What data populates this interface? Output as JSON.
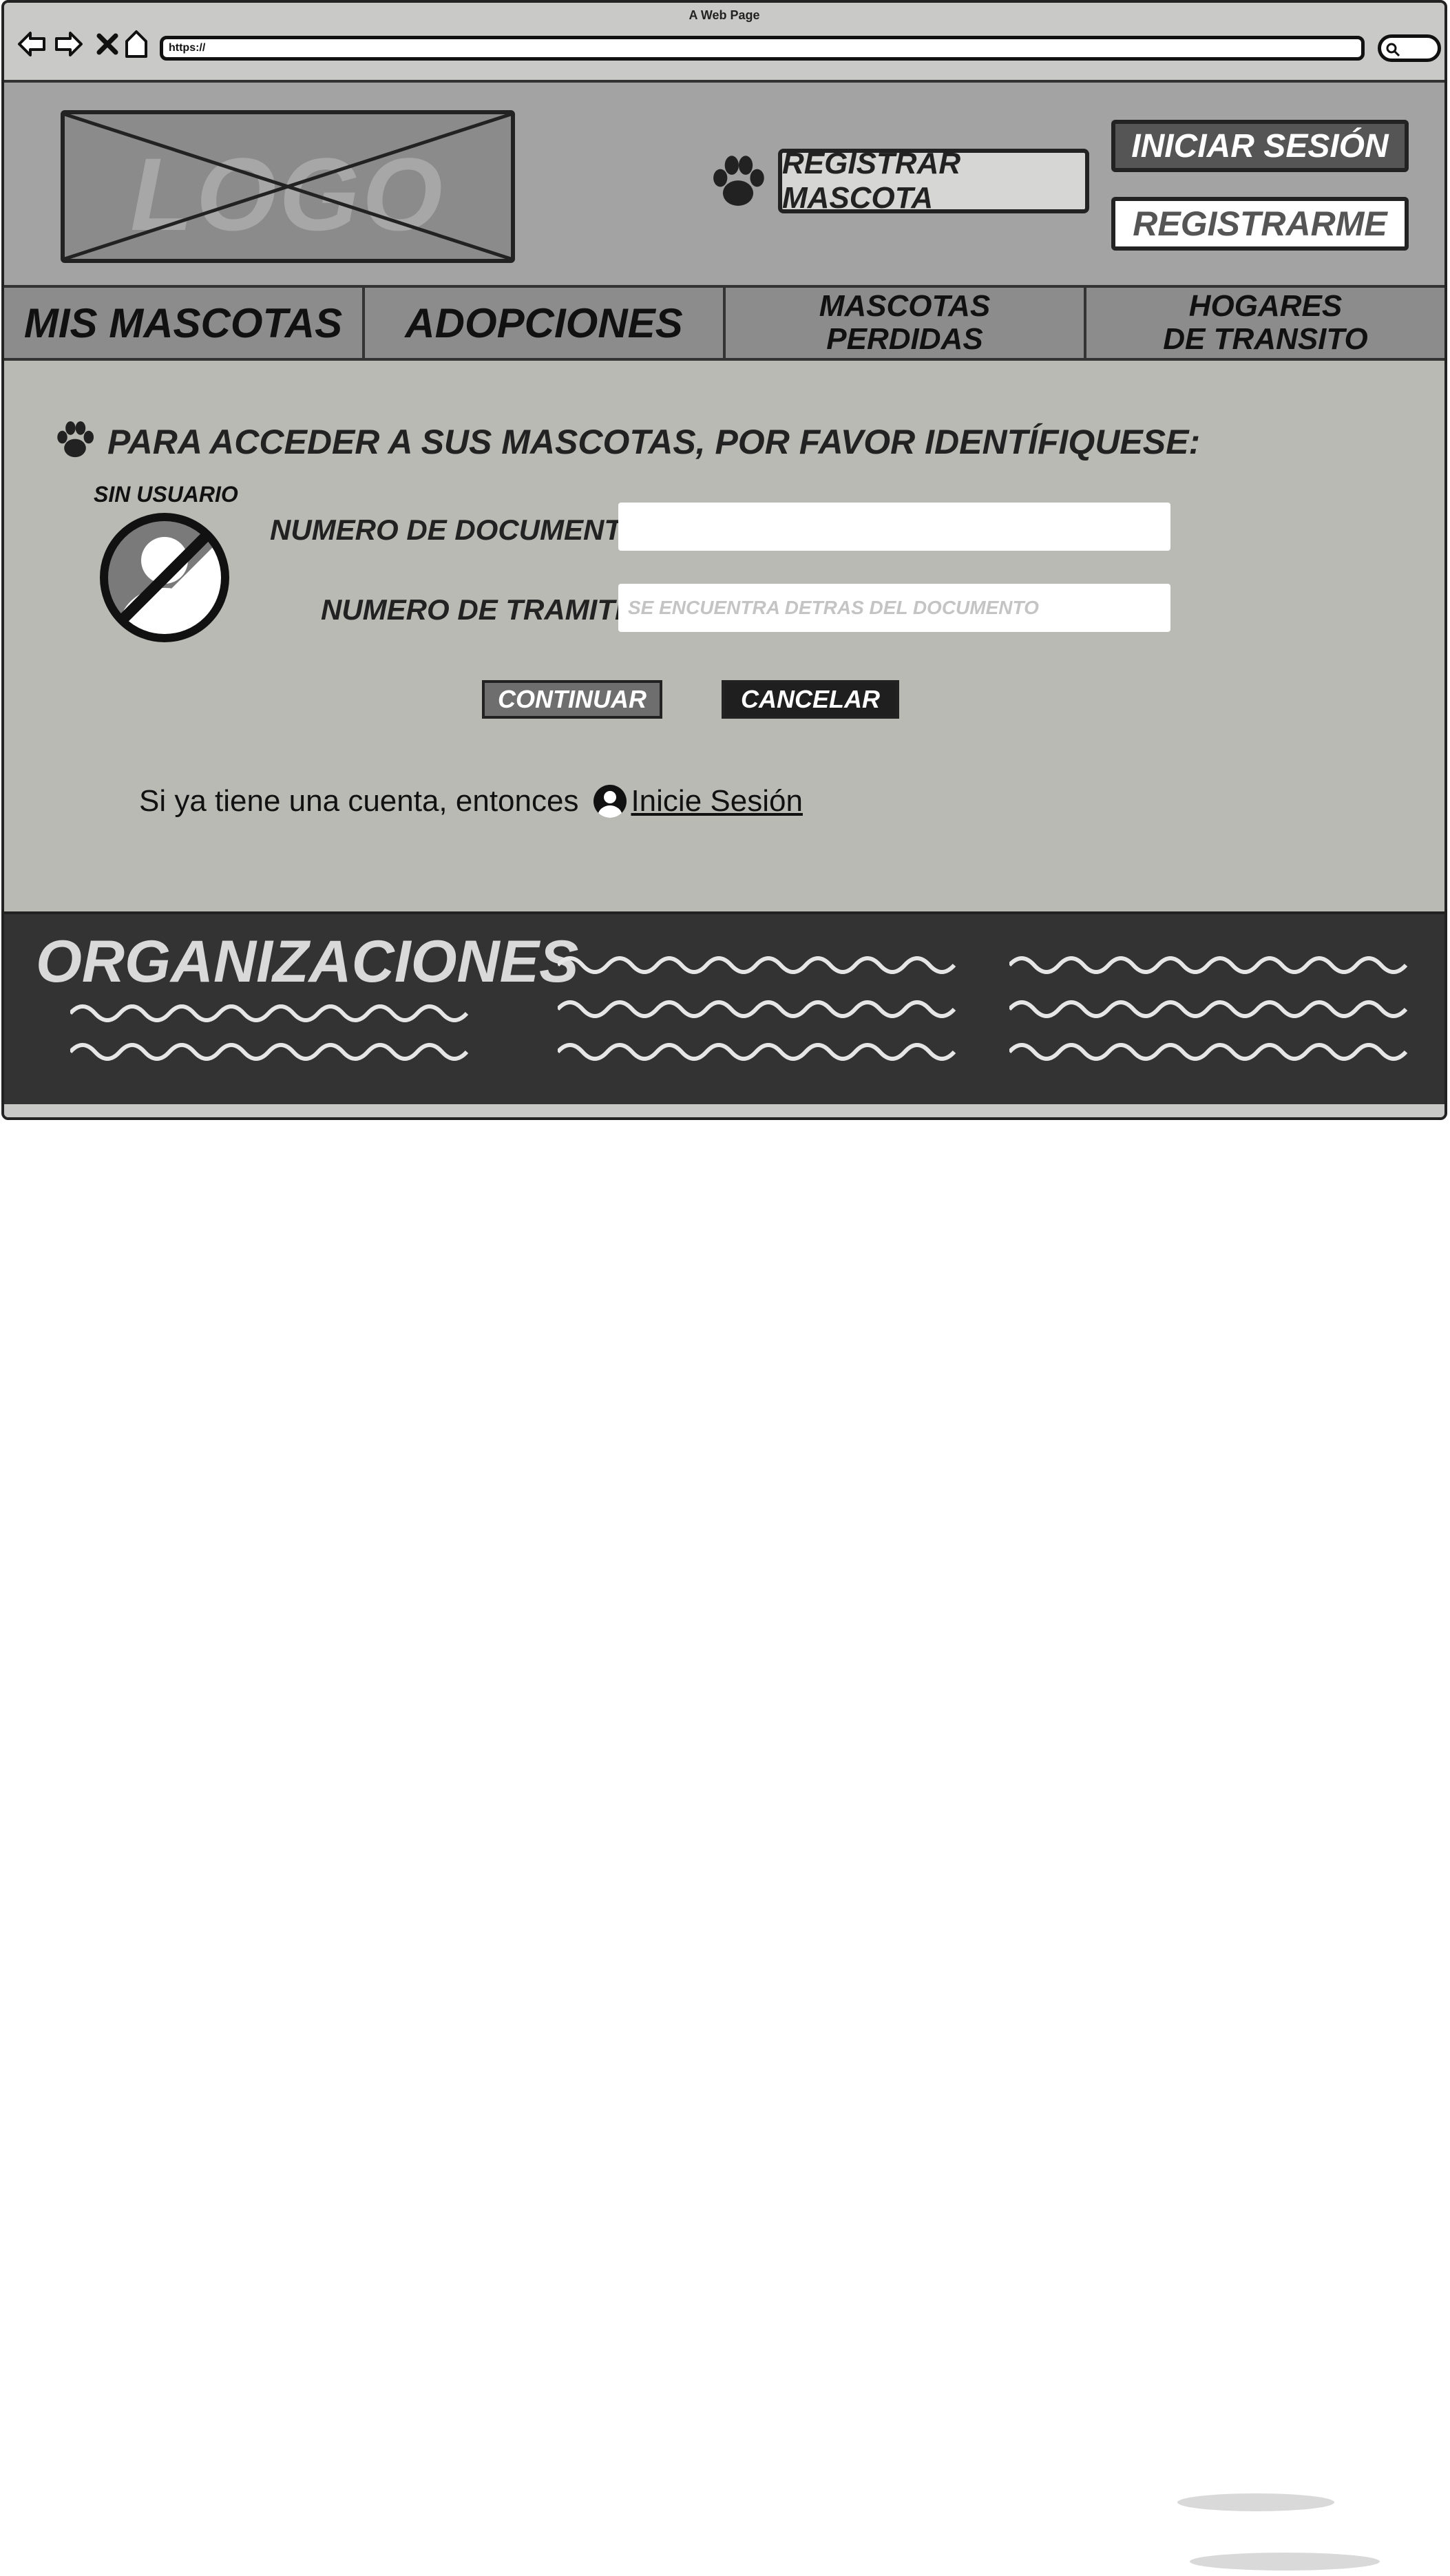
{
  "window": {
    "title": "A Web Page",
    "url": "https://"
  },
  "header": {
    "logo_text": "LOGO",
    "register_pet_label": "REGISTRAR MASCOTA",
    "login_label": "INICIAR SESIÓN",
    "signup_label": "REGISTRARME"
  },
  "nav": {
    "tabs": [
      {
        "label": "MIS MASCOTAS"
      },
      {
        "label": "ADOPCIONES"
      },
      {
        "label": "MASCOTAS\nPERDIDAS"
      },
      {
        "label": "HOGARES\nDE TRANSITO"
      }
    ]
  },
  "main": {
    "heading": "PARA ACCEDER A SUS MASCOTAS, POR FAVOR IDENTÍFIQUESE:",
    "no_user_label": "SIN USUARIO",
    "document_label": "NUMERO DE DOCUMENTO:",
    "document_value": "",
    "tramite_label": "NUMERO DE TRAMITE:",
    "tramite_placeholder": "SE ENCUENTRA DETRAS DEL DOCUMENTO",
    "continue_label": "CONTINUAR",
    "cancel_label": "CANCELAR",
    "account_prompt": "Si ya tiene una cuenta, entonces",
    "login_link": "Inicie Sesión"
  },
  "footer": {
    "title": "ORGANIZACIONES"
  },
  "colors": {
    "header_bg": "#a3a3a3",
    "nav_bg": "#8c8c8c",
    "main_bg": "#babab4",
    "footer_bg": "#333333",
    "login_btn": "#555555"
  },
  "icons": [
    "back-icon",
    "forward-icon",
    "stop-icon",
    "home-icon",
    "search-icon",
    "paw-icon",
    "no-user-icon",
    "user-icon"
  ]
}
